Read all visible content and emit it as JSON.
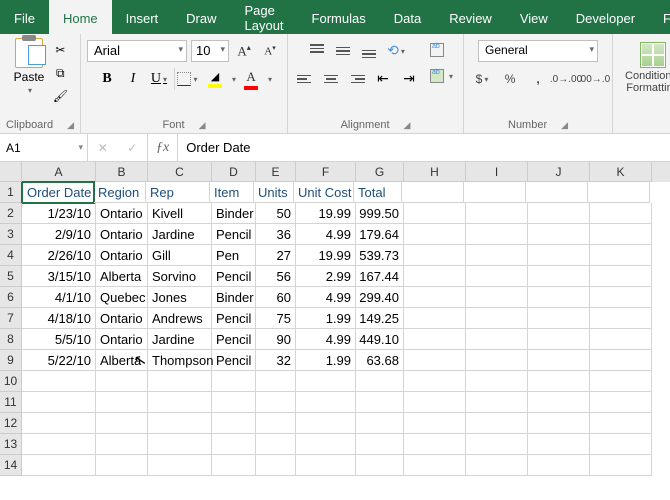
{
  "tabs": [
    "File",
    "Home",
    "Insert",
    "Draw",
    "Page Layout",
    "Formulas",
    "Data",
    "Review",
    "View",
    "Developer",
    "Fox"
  ],
  "active_tab": 1,
  "groups": {
    "clipboard": {
      "label": "Clipboard",
      "paste": "Paste"
    },
    "font": {
      "label": "Font",
      "name": "Arial",
      "size": "10"
    },
    "alignment": {
      "label": "Alignment",
      "wrap": "Wrap Text",
      "merge": "Merge & Center"
    },
    "number": {
      "label": "Number",
      "format": "General"
    },
    "styles": {
      "cond": "Conditional\nFormatting"
    }
  },
  "namebox": "A1",
  "formula": "Order Date",
  "columns": [
    "A",
    "B",
    "C",
    "D",
    "E",
    "F",
    "G",
    "H",
    "I",
    "J",
    "K"
  ],
  "col_widths": [
    "cA",
    "cB",
    "cC",
    "cD",
    "cE",
    "cF",
    "cG",
    "cH",
    "cI",
    "cJ",
    "cK"
  ],
  "headers": [
    "Order Date",
    "Region",
    "Rep",
    "Item",
    "Units",
    "Unit Cost",
    "Total"
  ],
  "rows": [
    {
      "date": "1/23/10",
      "region": "Ontario",
      "rep": "Kivell",
      "item": "Binder",
      "units": "50",
      "cost": "19.99",
      "total": "999.50"
    },
    {
      "date": "2/9/10",
      "region": "Ontario",
      "rep": "Jardine",
      "item": "Pencil",
      "units": "36",
      "cost": "4.99",
      "total": "179.64"
    },
    {
      "date": "2/26/10",
      "region": "Ontario",
      "rep": "Gill",
      "item": "Pen",
      "units": "27",
      "cost": "19.99",
      "total": "539.73"
    },
    {
      "date": "3/15/10",
      "region": "Alberta",
      "rep": "Sorvino",
      "item": "Pencil",
      "units": "56",
      "cost": "2.99",
      "total": "167.44"
    },
    {
      "date": "4/1/10",
      "region": "Quebec",
      "rep": "Jones",
      "item": "Binder",
      "units": "60",
      "cost": "4.99",
      "total": "299.40"
    },
    {
      "date": "4/18/10",
      "region": "Ontario",
      "rep": "Andrews",
      "item": "Pencil",
      "units": "75",
      "cost": "1.99",
      "total": "149.25"
    },
    {
      "date": "5/5/10",
      "region": "Ontario",
      "rep": "Jardine",
      "item": "Pencil",
      "units": "90",
      "cost": "4.99",
      "total": "449.10"
    },
    {
      "date": "5/22/10",
      "region": "Alberta",
      "rep": "Thompson",
      "item": "Pencil",
      "units": "32",
      "cost": "1.99",
      "total": "63.68"
    }
  ],
  "empty_row_count": 5
}
